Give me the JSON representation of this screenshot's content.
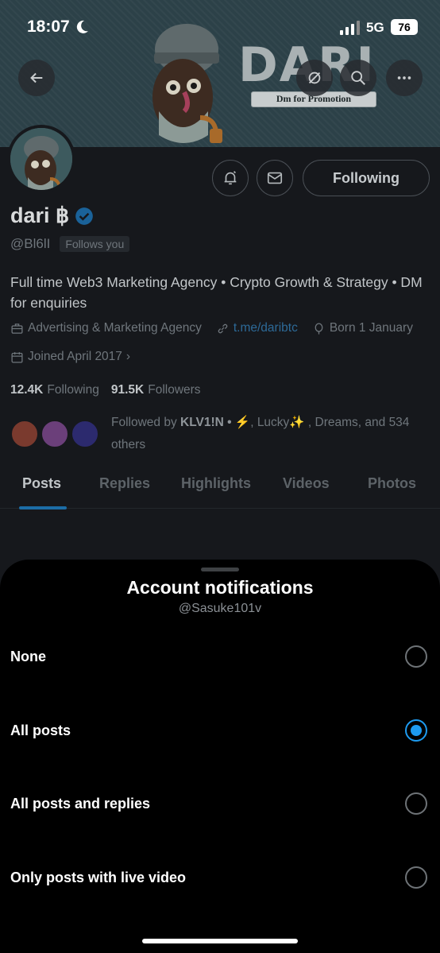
{
  "status_bar": {
    "time": "18:07",
    "network": "5G",
    "battery": "76"
  },
  "banner": {
    "brand_text": "DARI",
    "brand_tagline": "Dm for Promotion"
  },
  "profile": {
    "name": "dari ฿",
    "handle": "@Bl6lI",
    "follows_you": "Follows you",
    "following_button": "Following",
    "bio": "Full time Web3 Marketing Agency • Crypto Growth & Strategy • DM for enquiries",
    "category": "Advertising & Marketing Agency",
    "link": "t.me/daribtc",
    "born": "Born 1 January",
    "joined": "Joined April 2017",
    "following_count": "12.4K",
    "following_label": "Following",
    "followers_count": "91.5K",
    "followers_label": "Followers",
    "followed_by_prefix": "Followed by",
    "followed_by_names": "KLV1!N • ⚡",
    "followed_by_rest": ", Lucky✨ , Dreams, and 534 others"
  },
  "tabs": [
    {
      "label": "Posts",
      "active": true
    },
    {
      "label": "Replies",
      "active": false
    },
    {
      "label": "Highlights",
      "active": false
    },
    {
      "label": "Videos",
      "active": false
    },
    {
      "label": "Photos",
      "active": false
    }
  ],
  "sheet": {
    "title": "Account notifications",
    "subtitle": "@Sasuke101v",
    "options": [
      {
        "label": "None",
        "selected": false
      },
      {
        "label": "All posts",
        "selected": true
      },
      {
        "label": "All posts and replies",
        "selected": false
      },
      {
        "label": "Only posts with live video",
        "selected": false
      }
    ]
  },
  "colors": {
    "accent": "#1d9bf0",
    "sheet_bg": "#000000",
    "dim_bg": "#16181c"
  },
  "icons": [
    "back-arrow-icon",
    "mute-icon",
    "search-icon",
    "more-icon",
    "notification-bell-icon",
    "mail-icon",
    "verified-icon",
    "briefcase-icon",
    "link-icon",
    "balloon-icon",
    "calendar-icon"
  ]
}
